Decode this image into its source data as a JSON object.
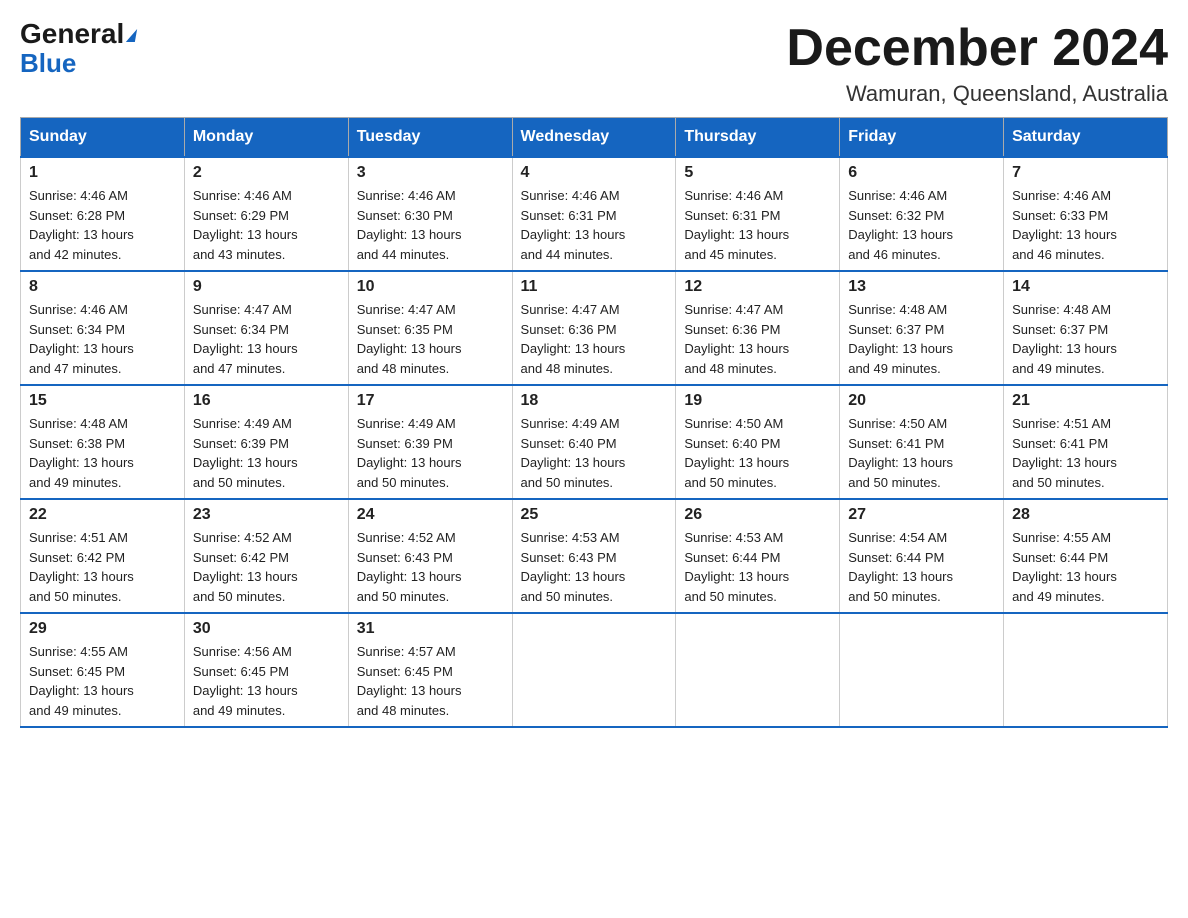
{
  "logo": {
    "general": "General",
    "triangle": "▶",
    "blue": "Blue"
  },
  "header": {
    "month_title": "December 2024",
    "location": "Wamuran, Queensland, Australia"
  },
  "days_of_week": [
    "Sunday",
    "Monday",
    "Tuesday",
    "Wednesday",
    "Thursday",
    "Friday",
    "Saturday"
  ],
  "weeks": [
    [
      {
        "day": "1",
        "sunrise": "4:46 AM",
        "sunset": "6:28 PM",
        "daylight": "13 hours and 42 minutes."
      },
      {
        "day": "2",
        "sunrise": "4:46 AM",
        "sunset": "6:29 PM",
        "daylight": "13 hours and 43 minutes."
      },
      {
        "day": "3",
        "sunrise": "4:46 AM",
        "sunset": "6:30 PM",
        "daylight": "13 hours and 44 minutes."
      },
      {
        "day": "4",
        "sunrise": "4:46 AM",
        "sunset": "6:31 PM",
        "daylight": "13 hours and 44 minutes."
      },
      {
        "day": "5",
        "sunrise": "4:46 AM",
        "sunset": "6:31 PM",
        "daylight": "13 hours and 45 minutes."
      },
      {
        "day": "6",
        "sunrise": "4:46 AM",
        "sunset": "6:32 PM",
        "daylight": "13 hours and 46 minutes."
      },
      {
        "day": "7",
        "sunrise": "4:46 AM",
        "sunset": "6:33 PM",
        "daylight": "13 hours and 46 minutes."
      }
    ],
    [
      {
        "day": "8",
        "sunrise": "4:46 AM",
        "sunset": "6:34 PM",
        "daylight": "13 hours and 47 minutes."
      },
      {
        "day": "9",
        "sunrise": "4:47 AM",
        "sunset": "6:34 PM",
        "daylight": "13 hours and 47 minutes."
      },
      {
        "day": "10",
        "sunrise": "4:47 AM",
        "sunset": "6:35 PM",
        "daylight": "13 hours and 48 minutes."
      },
      {
        "day": "11",
        "sunrise": "4:47 AM",
        "sunset": "6:36 PM",
        "daylight": "13 hours and 48 minutes."
      },
      {
        "day": "12",
        "sunrise": "4:47 AM",
        "sunset": "6:36 PM",
        "daylight": "13 hours and 48 minutes."
      },
      {
        "day": "13",
        "sunrise": "4:48 AM",
        "sunset": "6:37 PM",
        "daylight": "13 hours and 49 minutes."
      },
      {
        "day": "14",
        "sunrise": "4:48 AM",
        "sunset": "6:37 PM",
        "daylight": "13 hours and 49 minutes."
      }
    ],
    [
      {
        "day": "15",
        "sunrise": "4:48 AM",
        "sunset": "6:38 PM",
        "daylight": "13 hours and 49 minutes."
      },
      {
        "day": "16",
        "sunrise": "4:49 AM",
        "sunset": "6:39 PM",
        "daylight": "13 hours and 50 minutes."
      },
      {
        "day": "17",
        "sunrise": "4:49 AM",
        "sunset": "6:39 PM",
        "daylight": "13 hours and 50 minutes."
      },
      {
        "day": "18",
        "sunrise": "4:49 AM",
        "sunset": "6:40 PM",
        "daylight": "13 hours and 50 minutes."
      },
      {
        "day": "19",
        "sunrise": "4:50 AM",
        "sunset": "6:40 PM",
        "daylight": "13 hours and 50 minutes."
      },
      {
        "day": "20",
        "sunrise": "4:50 AM",
        "sunset": "6:41 PM",
        "daylight": "13 hours and 50 minutes."
      },
      {
        "day": "21",
        "sunrise": "4:51 AM",
        "sunset": "6:41 PM",
        "daylight": "13 hours and 50 minutes."
      }
    ],
    [
      {
        "day": "22",
        "sunrise": "4:51 AM",
        "sunset": "6:42 PM",
        "daylight": "13 hours and 50 minutes."
      },
      {
        "day": "23",
        "sunrise": "4:52 AM",
        "sunset": "6:42 PM",
        "daylight": "13 hours and 50 minutes."
      },
      {
        "day": "24",
        "sunrise": "4:52 AM",
        "sunset": "6:43 PM",
        "daylight": "13 hours and 50 minutes."
      },
      {
        "day": "25",
        "sunrise": "4:53 AM",
        "sunset": "6:43 PM",
        "daylight": "13 hours and 50 minutes."
      },
      {
        "day": "26",
        "sunrise": "4:53 AM",
        "sunset": "6:44 PM",
        "daylight": "13 hours and 50 minutes."
      },
      {
        "day": "27",
        "sunrise": "4:54 AM",
        "sunset": "6:44 PM",
        "daylight": "13 hours and 50 minutes."
      },
      {
        "day": "28",
        "sunrise": "4:55 AM",
        "sunset": "6:44 PM",
        "daylight": "13 hours and 49 minutes."
      }
    ],
    [
      {
        "day": "29",
        "sunrise": "4:55 AM",
        "sunset": "6:45 PM",
        "daylight": "13 hours and 49 minutes."
      },
      {
        "day": "30",
        "sunrise": "4:56 AM",
        "sunset": "6:45 PM",
        "daylight": "13 hours and 49 minutes."
      },
      {
        "day": "31",
        "sunrise": "4:57 AM",
        "sunset": "6:45 PM",
        "daylight": "13 hours and 48 minutes."
      },
      null,
      null,
      null,
      null
    ]
  ],
  "labels": {
    "sunrise": "Sunrise:",
    "sunset": "Sunset:",
    "daylight": "Daylight:"
  }
}
